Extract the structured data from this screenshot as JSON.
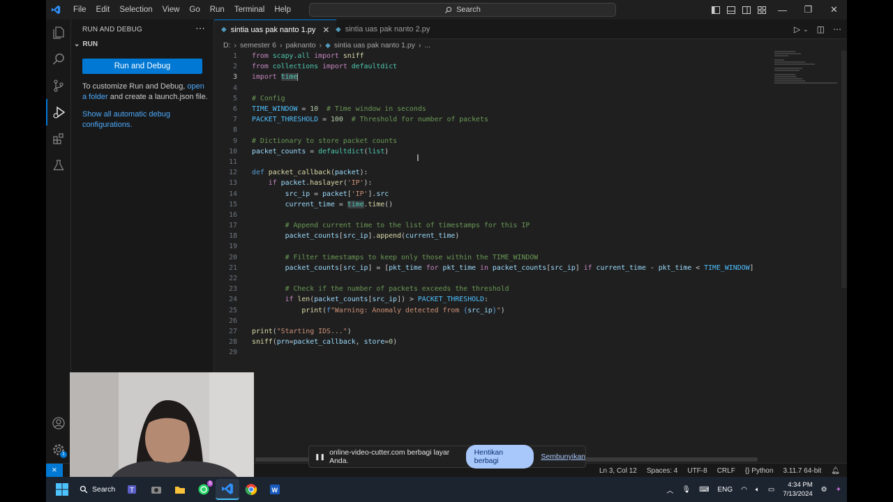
{
  "menu": [
    "File",
    "Edit",
    "Selection",
    "View",
    "Go",
    "Run",
    "Terminal",
    "Help"
  ],
  "search": {
    "label": "Search"
  },
  "sidebar": {
    "title": "RUN AND DEBUG",
    "section": "RUN",
    "run_button": "Run and Debug",
    "text_part1": "To customize Run and Debug, ",
    "link_open_folder": "open a folder",
    "text_part2": " and create a launch.json file.",
    "link_show_auto": "Show all automatic debug configurations."
  },
  "tabs": [
    {
      "label": "sintia uas pak nanto 1.py",
      "active": true
    },
    {
      "label": "sintia uas pak nanto 2.py",
      "active": false
    }
  ],
  "breadcrumb": [
    "D:",
    "semester 6",
    "paknanto",
    "sintia uas pak nanto 1.py",
    "..."
  ],
  "code": {
    "current_line": 3,
    "line_numbers": [
      "1",
      "2",
      "3",
      "4",
      "5",
      "6",
      "7",
      "8",
      "9",
      "10",
      "11",
      "12",
      "13",
      "14",
      "15",
      "16",
      "17",
      "18",
      "19",
      "20",
      "21",
      "22",
      "23",
      "24",
      "25",
      "26",
      "27",
      "28",
      "29"
    ]
  },
  "status": {
    "position": "Ln 3, Col 12",
    "spaces": "Spaces: 4",
    "encoding": "UTF-8",
    "eol": "CRLF",
    "language": "Python",
    "interpreter": "3.11.7 64-bit"
  },
  "share": {
    "message": "online-video-cutter.com berbagi layar Anda.",
    "stop": "Hentikan berbagi",
    "hide": "Sembunyikan"
  },
  "taskbar": {
    "search": "Search",
    "lang": "ENG",
    "time": "4:34 PM",
    "date": "7/13/2024"
  },
  "badges": {
    "settings": "1",
    "teams": "6"
  },
  "colors": {
    "accent": "#0078d4",
    "editor_bg": "#1f1f1f",
    "sidebar_bg": "#181818"
  }
}
